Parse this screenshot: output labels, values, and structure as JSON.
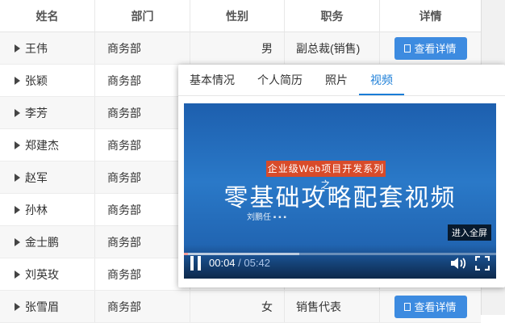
{
  "table": {
    "headers": [
      "姓名",
      "部门",
      "性别",
      "职务",
      "详情"
    ],
    "rows": [
      {
        "name": "王伟",
        "dept": "商务部",
        "gender": "男",
        "title": "副总裁(销售)",
        "action": "查看详情"
      },
      {
        "name": "张颖",
        "dept": "商务部",
        "gender": "",
        "title": "",
        "action": ""
      },
      {
        "name": "李芳",
        "dept": "商务部",
        "gender": "",
        "title": "",
        "action": ""
      },
      {
        "name": "郑建杰",
        "dept": "商务部",
        "gender": "",
        "title": "",
        "action": ""
      },
      {
        "name": "赵军",
        "dept": "商务部",
        "gender": "",
        "title": "",
        "action": ""
      },
      {
        "name": "孙林",
        "dept": "商务部",
        "gender": "",
        "title": "",
        "action": ""
      },
      {
        "name": "金士鹏",
        "dept": "商务部",
        "gender": "",
        "title": "",
        "action": ""
      },
      {
        "name": "刘英玫",
        "dept": "商务部",
        "gender": "",
        "title": "",
        "action": ""
      },
      {
        "name": "张雪眉",
        "dept": "商务部",
        "gender": "女",
        "title": "销售代表",
        "action": "查看详情"
      }
    ]
  },
  "popup": {
    "tabs": [
      "基本情况",
      "个人简历",
      "照片",
      "视频"
    ],
    "active_tab": "视频",
    "video": {
      "tag": "企业级Web项目开发系列之",
      "title": "零基础攻略配套视频",
      "subtitle": "刘鹏任 ▪ ▪ ▪",
      "fullscreen_tip": "进入全屏",
      "current_time": "00:04",
      "separator": " / ",
      "duration": "05:42",
      "progress": 0.012,
      "buffered": 0.37
    }
  },
  "colors": {
    "accent": "#1a7dd7",
    "button": "#3d8be0",
    "progress": "#e1251b"
  }
}
